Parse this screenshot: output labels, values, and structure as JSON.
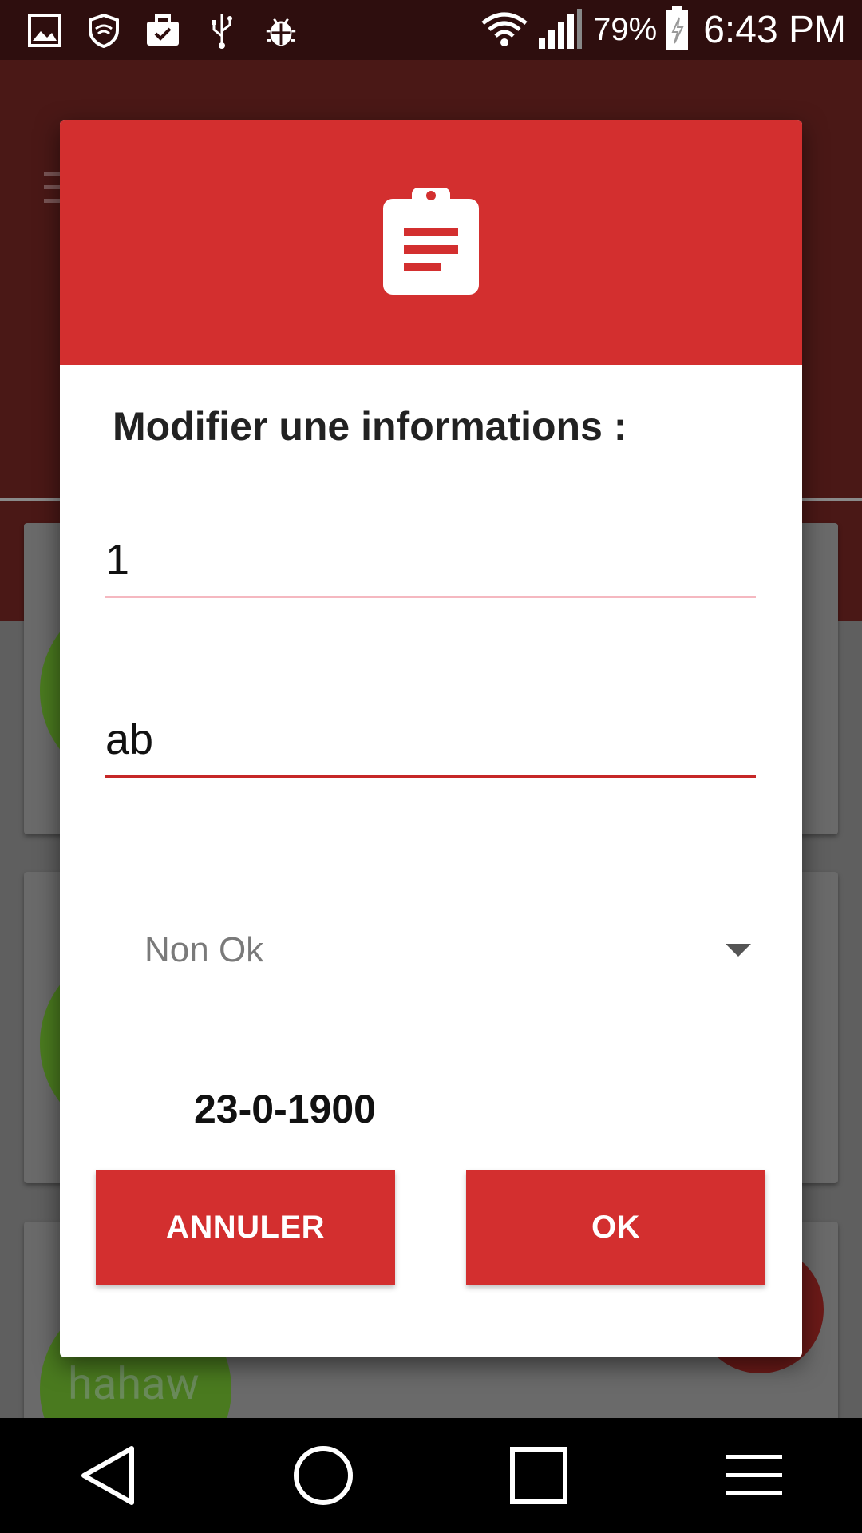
{
  "status_bar": {
    "battery": "79%",
    "time": "6:43 PM",
    "icons": [
      "image-icon",
      "vpn-shield-icon",
      "briefcase-check-icon",
      "usb-icon",
      "bug-icon",
      "wifi-icon",
      "signal-icon",
      "battery-charging-icon"
    ]
  },
  "background": {
    "cards": [
      {
        "avatar_text": "",
        "sub": ""
      },
      {
        "avatar_text": "",
        "sub": ""
      },
      {
        "avatar_text": "hahaw",
        "sub": ""
      }
    ]
  },
  "dialog": {
    "header_icon": "clipboard-icon",
    "title": "Modifier une informations :",
    "field1_value": "1",
    "field2_value": "ab",
    "spinner_value": "Non Ok",
    "date": "23-0-1900",
    "cancel_label": "ANNULER",
    "ok_label": "OK"
  },
  "nav_bar": {
    "icons": [
      "back-icon",
      "home-icon",
      "recents-icon",
      "menu-icon"
    ]
  },
  "colors": {
    "primary": "#d32f2f",
    "status_bar": "#2e0e0e",
    "header_dim": "#4a1816"
  }
}
